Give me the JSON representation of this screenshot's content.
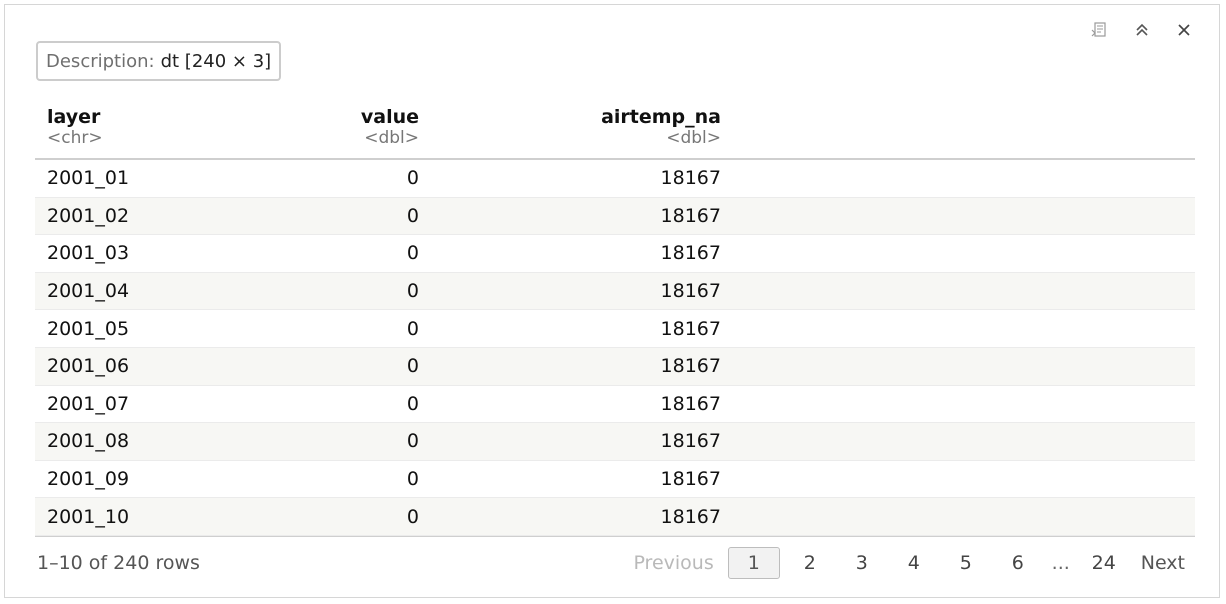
{
  "description": {
    "label": "Description:",
    "value": "dt [240 × 3]"
  },
  "toolbar": {
    "icons": [
      "export-icon",
      "collapse-icon",
      "close-icon"
    ]
  },
  "columns": [
    {
      "name": "layer",
      "type": "<chr>"
    },
    {
      "name": "value",
      "type": "<dbl>"
    },
    {
      "name": "airtemp_na",
      "type": "<dbl>"
    }
  ],
  "rows": [
    [
      "2001_01",
      "0",
      "18167"
    ],
    [
      "2001_02",
      "0",
      "18167"
    ],
    [
      "2001_03",
      "0",
      "18167"
    ],
    [
      "2001_04",
      "0",
      "18167"
    ],
    [
      "2001_05",
      "0",
      "18167"
    ],
    [
      "2001_06",
      "0",
      "18167"
    ],
    [
      "2001_07",
      "0",
      "18167"
    ],
    [
      "2001_08",
      "0",
      "18167"
    ],
    [
      "2001_09",
      "0",
      "18167"
    ],
    [
      "2001_10",
      "0",
      "18167"
    ]
  ],
  "footer": {
    "row_info": "1–10 of 240 rows",
    "previous_label": "Previous",
    "next_label": "Next",
    "pages": [
      "1",
      "2",
      "3",
      "4",
      "5",
      "6"
    ],
    "ellipsis": "...",
    "last_page": "24",
    "current_page": "1"
  }
}
